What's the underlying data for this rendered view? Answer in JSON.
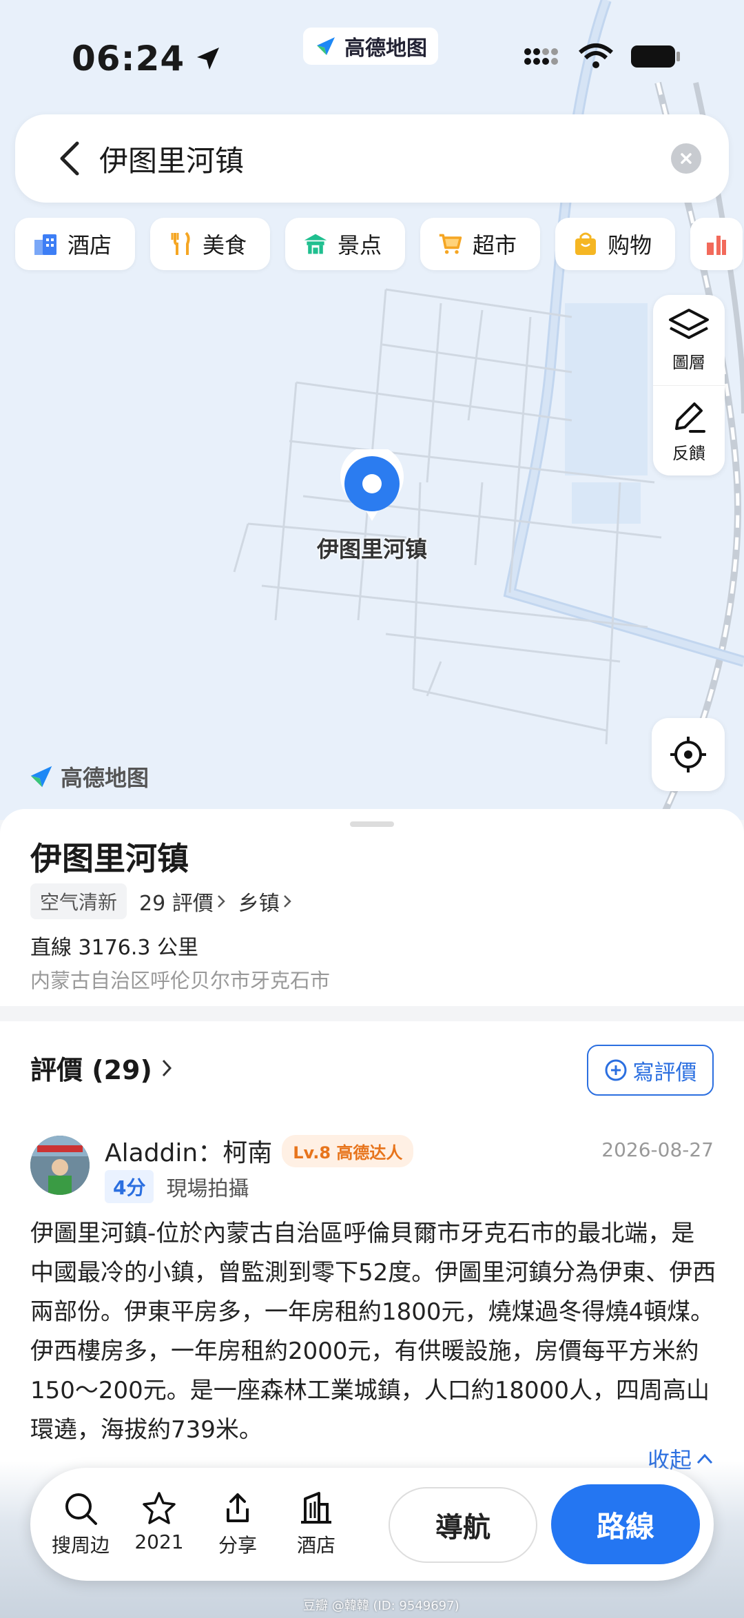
{
  "status": {
    "time": "06:24"
  },
  "app": {
    "name": "高德地图"
  },
  "search": {
    "query": "伊图里河镇"
  },
  "chips": [
    {
      "label": "酒店",
      "icon": "hotel-icon",
      "color": "#3d7ef5"
    },
    {
      "label": "美食",
      "icon": "food-icon",
      "color": "#f5a623"
    },
    {
      "label": "景点",
      "icon": "scenic-icon",
      "color": "#1fbf8f"
    },
    {
      "label": "超市",
      "icon": "cart-icon",
      "color": "#f5a623"
    },
    {
      "label": "购物",
      "icon": "bag-icon",
      "color": "#f5b623"
    }
  ],
  "map_tools": {
    "layers": "圖層",
    "feedback": "反饋"
  },
  "pin": {
    "label": "伊图里河镇"
  },
  "map_logo": "高德地图",
  "place": {
    "name": "伊图里河镇",
    "tag": "空气清新",
    "reviews_link": "29 評價",
    "category": "乡镇",
    "distance": "直線 3176.3 公里",
    "address": "内蒙古自治区呼伦贝尔市牙克石市"
  },
  "reviews": {
    "heading": "評價 (29)",
    "write_label": "寫評價",
    "items": [
      {
        "user": "Aladdin：柯南",
        "level": "Lv.8 高德达人",
        "date": "2026-08-27",
        "score": "4分",
        "tag": "現場拍攝",
        "text": "伊圖里河鎮-位於內蒙古自治區呼倫貝爾市牙克石市的最北端，是中國最冷的小鎮，曾監測到零下52度。伊圖里河鎮分為伊東、伊西兩部份。伊東平房多，一年房租約1800元，燒煤過冬得燒4頓煤。伊西樓房多，一年房租約2000元，有供暖設施，房價每平方米約150～200元。是一座森林工業城鎮，人口約18000人，四周高山環遶，海拔約739米。"
      }
    ],
    "collapse_label": "收起"
  },
  "bottom_bar": {
    "items": [
      {
        "label": "搜周边",
        "icon": "search-icon"
      },
      {
        "label": "2021",
        "icon": "star-icon"
      },
      {
        "label": "分享",
        "icon": "share-icon"
      },
      {
        "label": "酒店",
        "icon": "building-icon"
      }
    ],
    "navigate": "導航",
    "route": "路線"
  },
  "watermark": "豆瓣 @韓韓 (ID: 9549697)",
  "colors": {
    "accent": "#2476f2",
    "level_orange": "#e7741c",
    "map_bg": "#e8f0fa"
  }
}
